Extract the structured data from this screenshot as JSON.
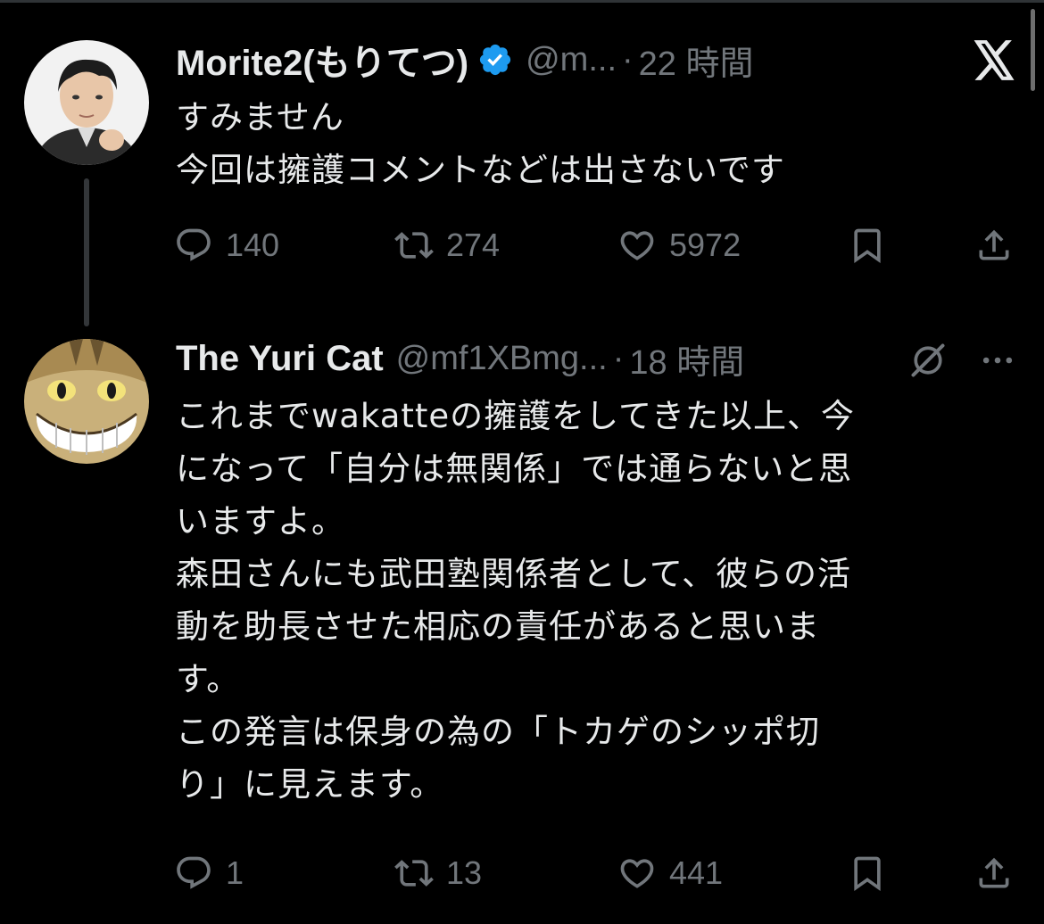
{
  "tweets": [
    {
      "name": "Morite2(もりてつ)",
      "handle": "@m...",
      "dot": "·",
      "time": "22 時間",
      "verified": true,
      "lines": [
        "すみません",
        "今回は擁護コメントなどは出さないです"
      ],
      "replies": "140",
      "retweets": "274",
      "likes": "5972"
    },
    {
      "name": "The Yuri Cat",
      "handle": "@mf1XBmg...",
      "dot": "·",
      "time": "18 時間",
      "verified": false,
      "lines": [
        "これまでwakatteの擁護をしてきた以上、今",
        "になって「自分は無関係」では通らないと思",
        "いますよ。",
        "森田さんにも武田塾関係者として、彼らの活",
        "動を助長させた相応の責任があると思いま",
        "す。",
        "この発言は保身の為の「トカゲのシッポ切",
        "り」に見えます。"
      ],
      "replies": "1",
      "retweets": "13",
      "likes": "441"
    }
  ],
  "icons": {
    "close": "x-logo-icon",
    "grok": "grok-icon",
    "more": "more-icon",
    "reply": "reply-icon",
    "retweet": "retweet-icon",
    "like": "like-icon",
    "bookmark": "bookmark-icon",
    "share": "share-icon"
  },
  "colors": {
    "background": "#000000",
    "text": "#e7e9ea",
    "secondary": "#71767b",
    "verified": "#1d9bf0"
  }
}
